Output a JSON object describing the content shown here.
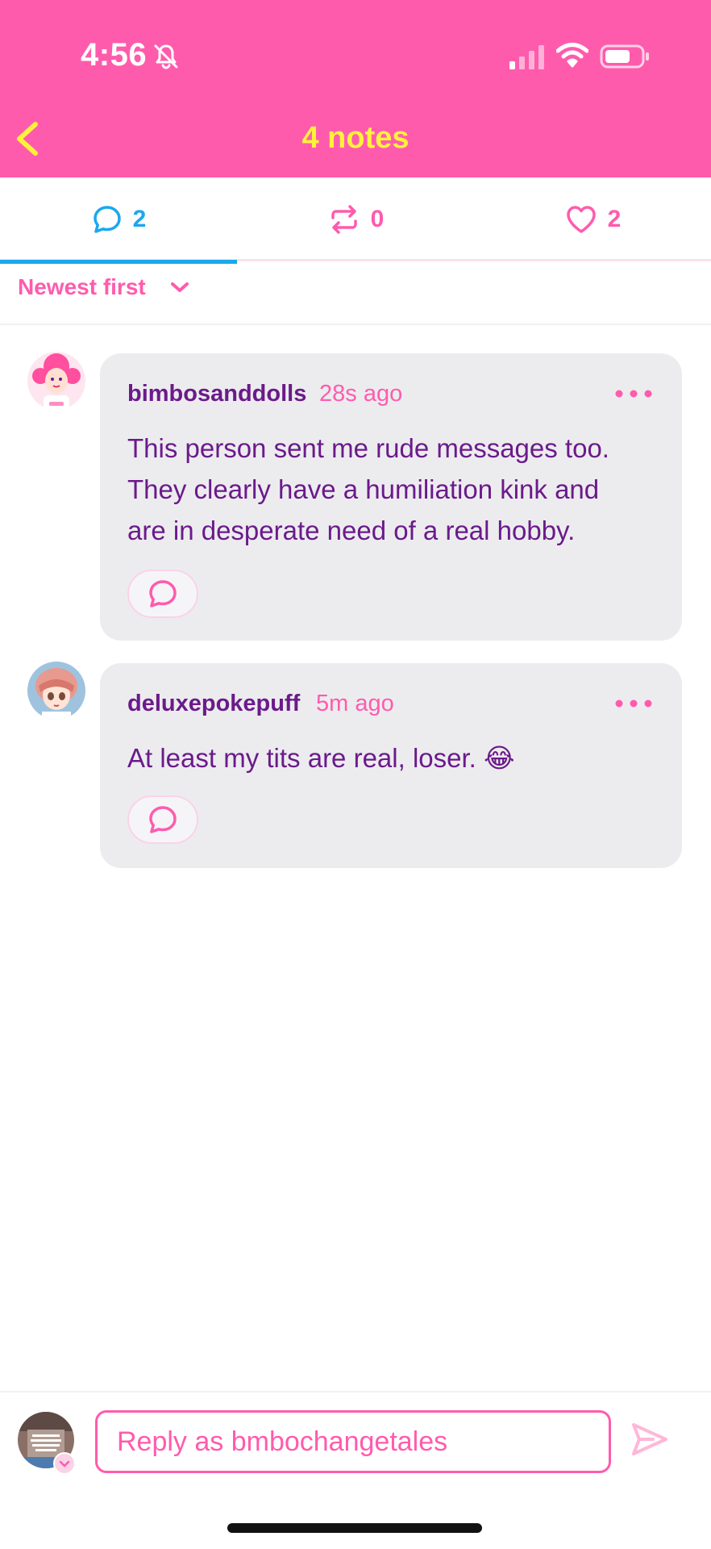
{
  "status_bar": {
    "time": "4:56",
    "icons": [
      "bell-off-icon",
      "cellular-signal-icon",
      "wifi-icon",
      "battery-icon"
    ]
  },
  "header": {
    "title": "4 notes",
    "back_icon": "chevron-left-icon"
  },
  "tabs": [
    {
      "icon": "comment-icon",
      "count": "2",
      "active": true
    },
    {
      "icon": "reblog-icon",
      "count": "0",
      "active": false
    },
    {
      "icon": "heart-icon",
      "count": "2",
      "active": false
    }
  ],
  "sort": {
    "label": "Newest first",
    "icon": "chevron-down-icon"
  },
  "notes": [
    {
      "username": "bimbosanddolls",
      "time": "28s ago",
      "text_lines": [
        "This person sent me rude messages too.",
        "They clearly have a humiliation kink and",
        "are in desperate need of a real hobby."
      ],
      "more_icon": "ellipsis-icon",
      "reply_icon": "comment-icon"
    },
    {
      "username": "deluxepokepuff",
      "time": "5m ago",
      "text_lines": [
        "At least my tits are real, loser. 😂"
      ],
      "more_icon": "ellipsis-icon",
      "reply_icon": "comment-icon"
    }
  ],
  "composer": {
    "placeholder": "Reply as bmbochangetales",
    "send_icon": "send-icon"
  },
  "colors": {
    "brand_pink": "#ff5bad",
    "title_yellow": "#fff23b",
    "active_blue": "#1aa8ee",
    "text_purple": "#6b1a8a",
    "bubble_gray": "#ececef"
  }
}
